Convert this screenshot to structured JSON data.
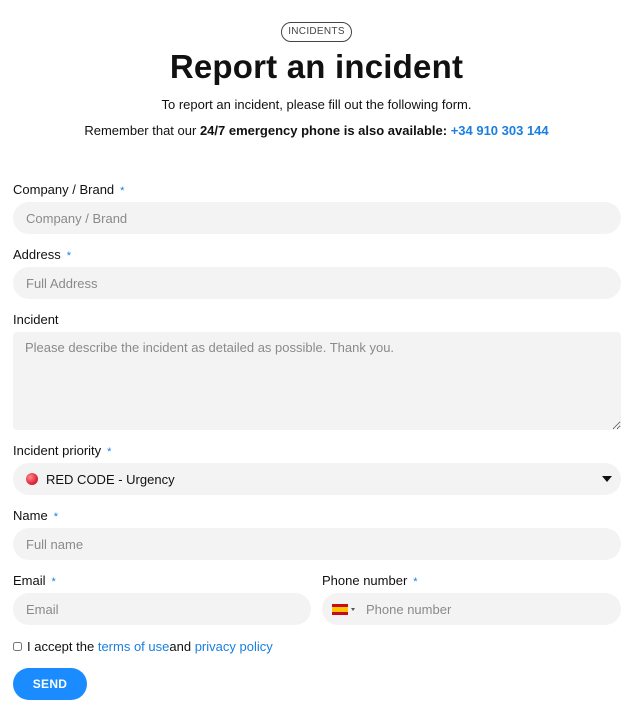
{
  "header": {
    "badge": "INCIDENTS",
    "title": "Report an incident",
    "intro": "To report an incident, please fill out the following form.",
    "reminder_prefix": "Remember that our ",
    "reminder_bold": "24/7 emergency phone is also available:",
    "emergency_phone": "+34 910 303 144"
  },
  "form": {
    "required_mark": "*",
    "company": {
      "label": "Company / Brand",
      "placeholder": "Company / Brand",
      "value": ""
    },
    "address": {
      "label": "Address",
      "placeholder": "Full Address",
      "value": ""
    },
    "incident": {
      "label": "Incident",
      "placeholder": "Please describe the incident as detailed as possible. Thank you.",
      "value": ""
    },
    "priority": {
      "label": "Incident priority",
      "selected": "RED CODE - Urgency",
      "dot_color": "#e0283c"
    },
    "name": {
      "label": "Name",
      "placeholder": "Full name",
      "value": ""
    },
    "email": {
      "label": "Email",
      "placeholder": "Email",
      "value": ""
    },
    "phone": {
      "label": "Phone number",
      "placeholder": "Phone number",
      "country_flag": "spain-flag-icon",
      "value": ""
    },
    "terms": {
      "prefix": "I accept the ",
      "terms_link": "terms of use",
      "middle": " and ",
      "privacy_link": "privacy policy",
      "checked": false
    },
    "submit_label": "SEND"
  },
  "colors": {
    "accent": "#1a7fe0",
    "button": "#1a8cff",
    "field_bg": "#f3f3f3"
  }
}
